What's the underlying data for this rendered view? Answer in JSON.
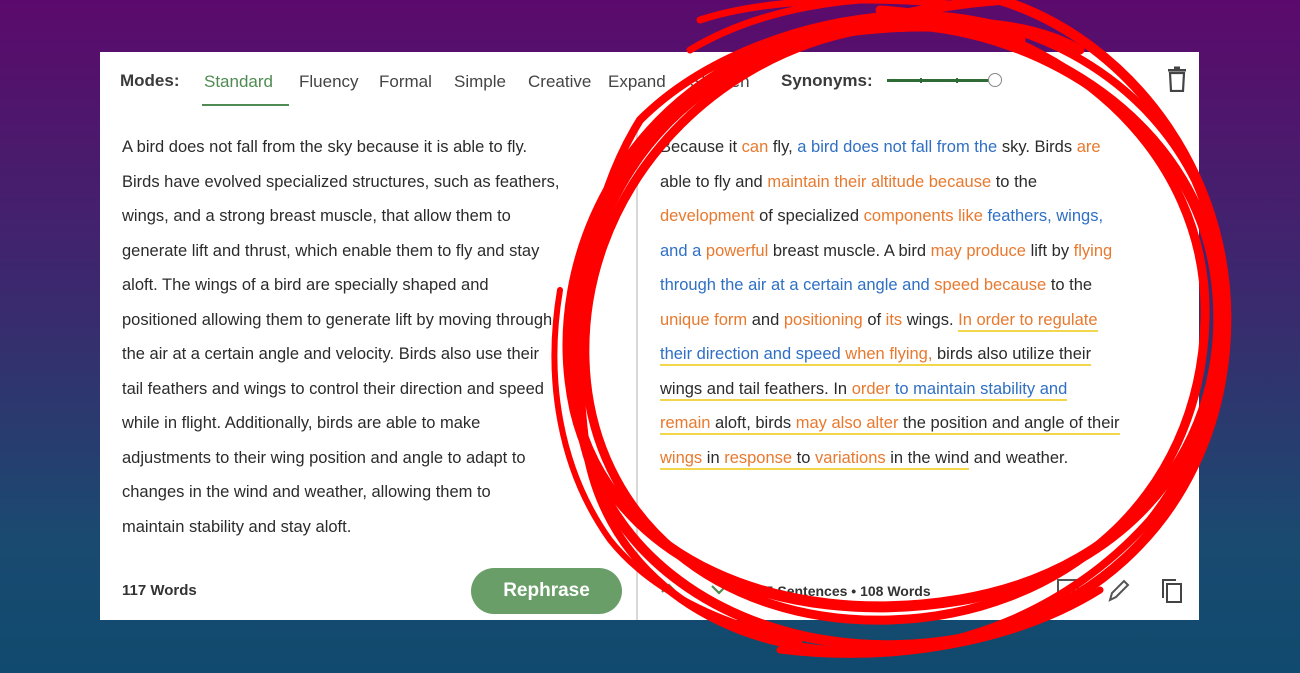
{
  "toolbar": {
    "modes_label": "Modes:",
    "tabs": [
      {
        "label": "Standard"
      },
      {
        "label": "Fluency"
      },
      {
        "label": "Formal"
      },
      {
        "label": "Simple"
      },
      {
        "label": "Creative"
      },
      {
        "label": "Expand"
      },
      {
        "label": "Shorten"
      }
    ],
    "synonyms_label": "Synonyms:",
    "delete_icon": "trash-icon"
  },
  "input": {
    "lines": [
      "A bird does not fall from the sky because it is able to fly.",
      "Birds have evolved specialized structures, such as feathers,",
      "wings, and a strong breast muscle, that allow them to",
      "generate lift and thrust, which enable them to fly and stay",
      "aloft. The wings of a bird are specially shaped and",
      "positioned allowing them to generate lift by moving through",
      "the air at a certain angle and velocity. Birds also use their",
      "tail feathers and wings to control their direction and speed",
      "while in flight. Additionally, birds are able to make",
      "adjustments to their wing position and angle to adapt to",
      "changes in the wind and weather, allowing them to",
      "maintain stability and stay aloft."
    ],
    "word_count": "117 Words",
    "rephrase_label": "Rephrase"
  },
  "output": {
    "lines": [
      [
        [
          "Because it ",
          ""
        ],
        [
          "can",
          "o"
        ],
        [
          " fly, ",
          ""
        ],
        [
          "a bird does not fall from the",
          "b"
        ],
        [
          " sky. Birds ",
          ""
        ],
        [
          "are",
          "o"
        ]
      ],
      [
        [
          "able to fly and ",
          ""
        ],
        [
          "maintain their altitude because",
          "o"
        ],
        [
          " to the",
          ""
        ]
      ],
      [
        [
          "development",
          "o"
        ],
        [
          " of specialized ",
          ""
        ],
        [
          "components like",
          "o"
        ],
        [
          " ",
          ""
        ],
        [
          "feathers, wings,",
          "b"
        ]
      ],
      [
        [
          "and a",
          "b"
        ],
        [
          " ",
          ""
        ],
        [
          "powerful",
          "o"
        ],
        [
          " breast muscle. A bird ",
          ""
        ],
        [
          "may produce",
          "o"
        ],
        [
          " lift by ",
          ""
        ],
        [
          "flying",
          "o"
        ]
      ],
      [
        [
          "through the air at a certain angle and",
          "b"
        ],
        [
          " ",
          ""
        ],
        [
          "speed because",
          "o"
        ],
        [
          " to the",
          ""
        ]
      ],
      [
        [
          "unique form",
          "o"
        ],
        [
          " and ",
          ""
        ],
        [
          "positioning",
          "o"
        ],
        [
          " of ",
          ""
        ],
        [
          "its",
          "o"
        ],
        [
          " wings. ",
          ""
        ],
        [
          "In order to regulate",
          "ou"
        ]
      ],
      [
        [
          "their direction and speed",
          "bu"
        ],
        [
          " when flying,",
          "ou"
        ],
        [
          " birds also utilize their",
          "u"
        ]
      ],
      [
        [
          "wings and tail feathers. In ",
          "u"
        ],
        [
          "order",
          "ou"
        ],
        [
          " to maintain stability and",
          "bu"
        ]
      ],
      [
        [
          "remain",
          "ou"
        ],
        [
          " aloft, birds ",
          "u"
        ],
        [
          "may also alter",
          "ou"
        ],
        [
          " the position and angle of their",
          "u"
        ]
      ],
      [
        [
          "wings",
          "ou"
        ],
        [
          " in ",
          "u"
        ],
        [
          "response",
          "ou"
        ],
        [
          " to ",
          "u"
        ],
        [
          "variations",
          "ou"
        ],
        [
          " in the wind",
          "u"
        ],
        [
          " and weather.",
          ""
        ]
      ]
    ],
    "sentence_info": "1/5 Sentences • 108 Words",
    "icons": [
      "chevron-up-icon",
      "chevron-down-icon",
      "chart-icon",
      "edit-icon",
      "copy-icon"
    ]
  },
  "colors": {
    "accent_green": "#4f8b52",
    "rephrase_button": "#6a9e68",
    "changed_word_orange": "#e8792e",
    "structural_change_blue": "#2f6fc4",
    "highlight_yellow": "#f2d64b",
    "scribble_red": "#ff0000"
  }
}
